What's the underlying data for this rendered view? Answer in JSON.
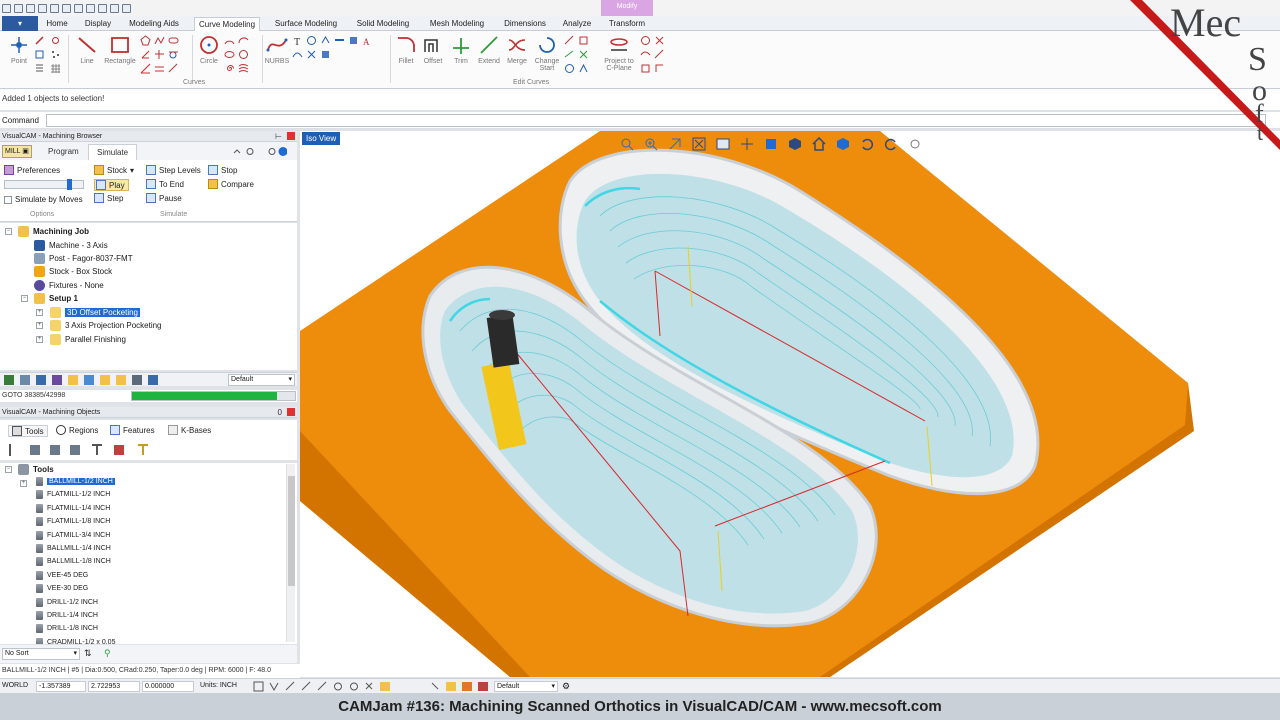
{
  "ribbon": {
    "tabs": [
      "Home",
      "Display",
      "Modeling Aids",
      "Curve Modeling",
      "Surface Modeling",
      "Solid Modeling",
      "Mesh Modeling",
      "Dimensions",
      "Analyze",
      "Transform"
    ],
    "active_tab": "Curve Modeling",
    "context_tab": "Modify",
    "buttons": {
      "point": "Point",
      "line": "Line",
      "rectangle": "Rectangle",
      "circle": "Circle",
      "nurbs": "NURBS",
      "fillet": "Fillet",
      "offset": "Offset",
      "trim": "Trim",
      "extend": "Extend",
      "merge": "Merge",
      "change_start": "Change Start",
      "project": "Project to C-Plane"
    },
    "groups": {
      "curves": "Curves",
      "edit_curves": "Edit Curves"
    }
  },
  "status_message": "Added 1 objects to selection!",
  "command": {
    "label": "Command",
    "value": ""
  },
  "machining_browser": {
    "title": "VisualCAM - Machining Browser",
    "mill_tab": "MILL",
    "tabs": [
      "Program",
      "Simulate"
    ],
    "active_tab": "Simulate",
    "simulate": {
      "preferences": "Preferences",
      "simulate_by_moves": "Simulate by Moves",
      "stock": "Stock",
      "play": "Play",
      "step": "Step",
      "step_levels": "Step Levels",
      "to_end": "To End",
      "pause": "Pause",
      "stop": "Stop",
      "compare": "Compare",
      "options_label": "Options",
      "simulate_label": "Simulate"
    },
    "tree": {
      "root": "Machining Job",
      "items": [
        "Machine - 3 Axis",
        "Post - Fagor-8037-FMT",
        "Stock - Box Stock",
        "Fixtures - None"
      ],
      "setup": "Setup 1",
      "operations": [
        "3D Offset Pocketing",
        "3 Axis Projection Pocketing",
        "Parallel Finishing"
      ],
      "selected": "3D Offset Pocketing"
    },
    "toolbar_default": "Default",
    "goto": "GOTO 38385/42998",
    "progress": 0.89
  },
  "machining_objects": {
    "title": "VisualCAM - Machining Objects",
    "tabs": [
      "Tools",
      "Regions",
      "Features",
      "K-Bases"
    ],
    "tools_root": "Tools",
    "tools": [
      "BALLMILL-1/2 INCH",
      "FLATMILL-1/2 INCH",
      "FLATMILL-1/4 INCH",
      "FLATMILL-1/8 INCH",
      "FLATMILL-3/4 INCH",
      "BALLMILL-1/4 INCH",
      "BALLMILL-1/8 INCH",
      "VEE-45 DEG",
      "VEE-30 DEG",
      "DRILL-1/2 INCH",
      "DRILL-1/4 INCH",
      "DRILL-1/8 INCH",
      "CRADMILL-1/2 x 0.05"
    ],
    "selected_tool": "BALLMILL-1/2 INCH",
    "sort": "No Sort"
  },
  "tool_info": "BALLMILL-1/2 INCH | #5 | Dia:0.500, CRad:0.250, Taper:0.0 deg | RPM: 6000 | F: 48.0",
  "coords": {
    "mode": "WORLD",
    "x": "-1.357389",
    "y": "2.722953",
    "z": "0.000000",
    "units": "Units: INCH",
    "layer": "Default"
  },
  "viewport": {
    "label": "Iso View"
  },
  "logo": {
    "text": "MecSoft"
  },
  "caption": "CAMJam #136: Machining Scanned Orthotics in VisualCAD/CAM - www.mecsoft.com",
  "colors": {
    "stock": "#ee8c0b",
    "part": "#bfe0e6",
    "toolpath": "#32d6e6",
    "tool_shank": "#f2c61a",
    "accent": "#1f6ad3"
  }
}
